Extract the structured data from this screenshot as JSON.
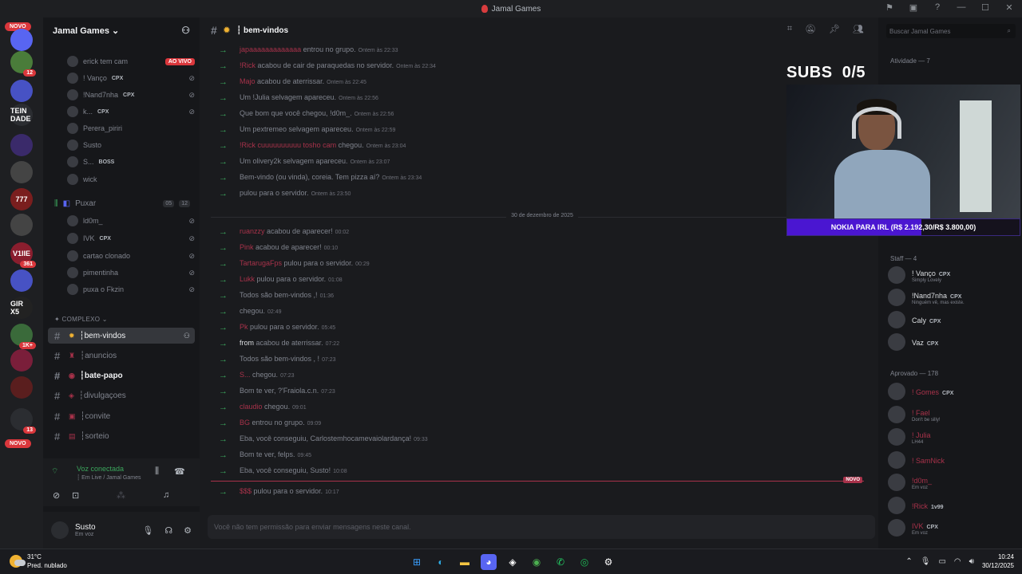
{
  "window": {
    "title": "Jamal Games"
  },
  "server_rail": {
    "top_badge": "NOVO",
    "bottom_badge": "NOVO",
    "servers": [
      {
        "label": "",
        "badge": ""
      },
      {
        "label": "",
        "badge": "12"
      },
      {
        "label": "",
        "badge": ""
      },
      {
        "label": "TEIN DADE",
        "badge": ""
      },
      {
        "label": "",
        "badge": ""
      },
      {
        "label": "",
        "badge": ""
      },
      {
        "label": "777",
        "badge": ""
      },
      {
        "label": "",
        "badge": ""
      },
      {
        "label": "V1IIE",
        "badge": "361"
      },
      {
        "label": "",
        "badge": ""
      },
      {
        "label": "GIR X5",
        "badge": ""
      },
      {
        "label": "",
        "badge": "1K+"
      },
      {
        "label": "",
        "badge": ""
      },
      {
        "label": "",
        "badge": ""
      },
      {
        "label": "",
        "badge": "13"
      }
    ]
  },
  "guild": {
    "name": "Jamal Games ⌄"
  },
  "voice_users_top": [
    {
      "name": "erick tem cam",
      "tag": "",
      "status": "AO VIVO"
    },
    {
      "name": "! Vanço",
      "tag": "CPX",
      "status": ""
    },
    {
      "name": "!Nand7nha",
      "tag": "CPX",
      "status": ""
    },
    {
      "name": "k...",
      "tag": "CPX",
      "status": ""
    },
    {
      "name": "Perera_piriri",
      "tag": "",
      "status": ""
    },
    {
      "name": "Susto",
      "tag": "",
      "status": ""
    },
    {
      "name": "S...",
      "tag": "BOSS",
      "status": ""
    },
    {
      "name": "wick",
      "tag": "",
      "status": ""
    }
  ],
  "voice_channel_puxar": {
    "name": "Puxar",
    "count_a": "05",
    "count_b": "12"
  },
  "voice_users_puxar": [
    {
      "name": "ld0m_",
      "tag": ""
    },
    {
      "name": "IVK",
      "tag": "CPX"
    },
    {
      "name": "cartao clonado",
      "tag": ""
    },
    {
      "name": "pimentinha",
      "tag": ""
    },
    {
      "name": "puxa o Fkzin",
      "tag": ""
    }
  ],
  "category": "✦ COMPLEXO ⌄",
  "text_channels": [
    {
      "name": "bem-vindos",
      "prefix": "┆ ",
      "active": true,
      "bold": false
    },
    {
      "name": "anuncios",
      "prefix": "┆ ",
      "active": false,
      "bold": false
    },
    {
      "name": "bate-papo",
      "prefix": "┆ ",
      "active": false,
      "bold": true
    },
    {
      "name": "divulgaçoes",
      "prefix": "┆ ",
      "active": false,
      "bold": false
    },
    {
      "name": "convite",
      "prefix": "┆ ",
      "active": false,
      "bold": false
    },
    {
      "name": "sorteio",
      "prefix": "┆ ",
      "active": false,
      "bold": false
    }
  ],
  "voice_connected": {
    "title": "Voz conectada",
    "subtitle": "┆ Em Live / Jamal Games"
  },
  "user_panel": {
    "name": "Susto",
    "status": "Em voz"
  },
  "channel_header": {
    "name": "┆ bem-vindos",
    "search_placeholder": "Buscar Jamal Games"
  },
  "messages_before": [
    {
      "user": "japaaaaaaaaaaaaa",
      "text": "entrou no grupo.",
      "time": "Ontem às 22:33"
    },
    {
      "user": "!Rick",
      "text": "acabou de cair de paraquedas no servidor.",
      "time": "Ontem às 22:34"
    },
    {
      "user": "Majo",
      "text": "acabou de aterrissar.",
      "time": "Ontem às 22:45"
    },
    {
      "user": "",
      "text": "Um !Julia selvagem apareceu.",
      "time": "Ontem às 22:56"
    },
    {
      "user": "",
      "text": "Que bom que você chegou, !d0m_.",
      "time": "Ontem às 22:56"
    },
    {
      "user": "",
      "text": "Um pextremeo selvagem apareceu.",
      "time": "Ontem às 22:59"
    },
    {
      "user": "!Rick cuuuuuuuuuu tosho cam",
      "text": "chegou.",
      "time": "Ontem às 23:04"
    },
    {
      "user": "",
      "text": "Um olivery2k selvagem apareceu.",
      "time": "Ontem às 23:07"
    },
    {
      "user": "",
      "text": "Bem-vindo (ou vinda), coreia. Tem pizza aí?",
      "time": "Ontem às 23:34"
    },
    {
      "user": "",
      "text": "pulou para o servidor.",
      "time": "Ontem às 23:50"
    }
  ],
  "date_separator": "30 de dezembro de 2025",
  "messages_after": [
    {
      "user": "ruanzzy",
      "text": "acabou de aparecer!",
      "time": "00:02"
    },
    {
      "user": "Pink",
      "text": "acabou de aparecer!",
      "time": "00:10"
    },
    {
      "user": "TartarugaFps",
      "text": "pulou para o servidor.",
      "time": "00:29"
    },
    {
      "user": "Lukk",
      "text": "pulou para o servidor.",
      "time": "01:08"
    },
    {
      "user": "",
      "text": "Todos são bem-vindos ,!",
      "time": "01:36"
    },
    {
      "user": "",
      "text": "chegou.",
      "time": "02:49"
    },
    {
      "user": "Pk",
      "text": "pulou para o servidor.",
      "time": "05:45"
    },
    {
      "user": "from",
      "text": "acabou de aterrissar.",
      "time": "07:22"
    },
    {
      "user": "",
      "text": "Todos são bem-vindos , !",
      "time": "07:23"
    },
    {
      "user": "S...",
      "text": "chegou.",
      "time": "07:23"
    },
    {
      "user": "",
      "text": "Bom te ver, ?'Fraiola.c.n.",
      "time": "07:23"
    },
    {
      "user": "claudio",
      "text": "chegou.",
      "time": "09:01"
    },
    {
      "user": "BG",
      "text": "entrou no grupo.",
      "time": "09:09"
    },
    {
      "user": "",
      "text": "Eba, você conseguiu, Carlostemhocamevaiolardança!",
      "time": "09:33"
    },
    {
      "user": "",
      "text": "Bom te ver, felps.",
      "time": "09:45"
    },
    {
      "user": "",
      "text": "Eba, você conseguiu, Susto!",
      "time": "10:08"
    }
  ],
  "new_label": "NOVO",
  "last_message": {
    "user": "$$$",
    "text": "pulou para o servidor.",
    "time": "10:17"
  },
  "chat_input": {
    "placeholder": "Você não tem permissão para enviar mensagens neste canal."
  },
  "members": {
    "activity_header": "Atividade — 7",
    "staff_header": "Staff — 4",
    "approved_header": "Aprovado — 178",
    "staff": [
      {
        "name": "! Vanço",
        "tag": "CPX",
        "status": "Simply Lovely"
      },
      {
        "name": "!Nand7nha",
        "tag": "CPX",
        "status": "Ninguém vê, mas existe."
      },
      {
        "name": "Caly",
        "tag": "CPX",
        "status": ""
      },
      {
        "name": "Vaz",
        "tag": "CPX",
        "status": ""
      }
    ],
    "approved": [
      {
        "name": "! Gomes",
        "tag": "CPX",
        "status": ""
      },
      {
        "name": "! Fael",
        "tag": "",
        "status": "Don't be silly!"
      },
      {
        "name": "! Julia",
        "tag": "",
        "status": "LH44"
      },
      {
        "name": "! SamNick",
        "tag": "",
        "status": ""
      },
      {
        "name": "!d0m_",
        "tag": "",
        "status": "Em voz"
      },
      {
        "name": "!Rick",
        "tag": "1v99",
        "status": ""
      },
      {
        "name": "IVK",
        "tag": "CPX",
        "status": "Em voz"
      }
    ]
  },
  "overlay": {
    "subs_label": "SUBS",
    "subs_count": "0/5",
    "goal_text": "NOKIA PARA IRL (R$ 2.192,30/R$ 3.800,00)",
    "goal_progress": 0.577
  },
  "taskbar": {
    "temp": "31°C",
    "weather": "Pred. nublado",
    "time": "10:24",
    "date": "30/12/2025"
  },
  "colors": {
    "accent_red": "#a8324a",
    "progress": "#4a16d1",
    "join_arrow": "#3ba55c"
  }
}
